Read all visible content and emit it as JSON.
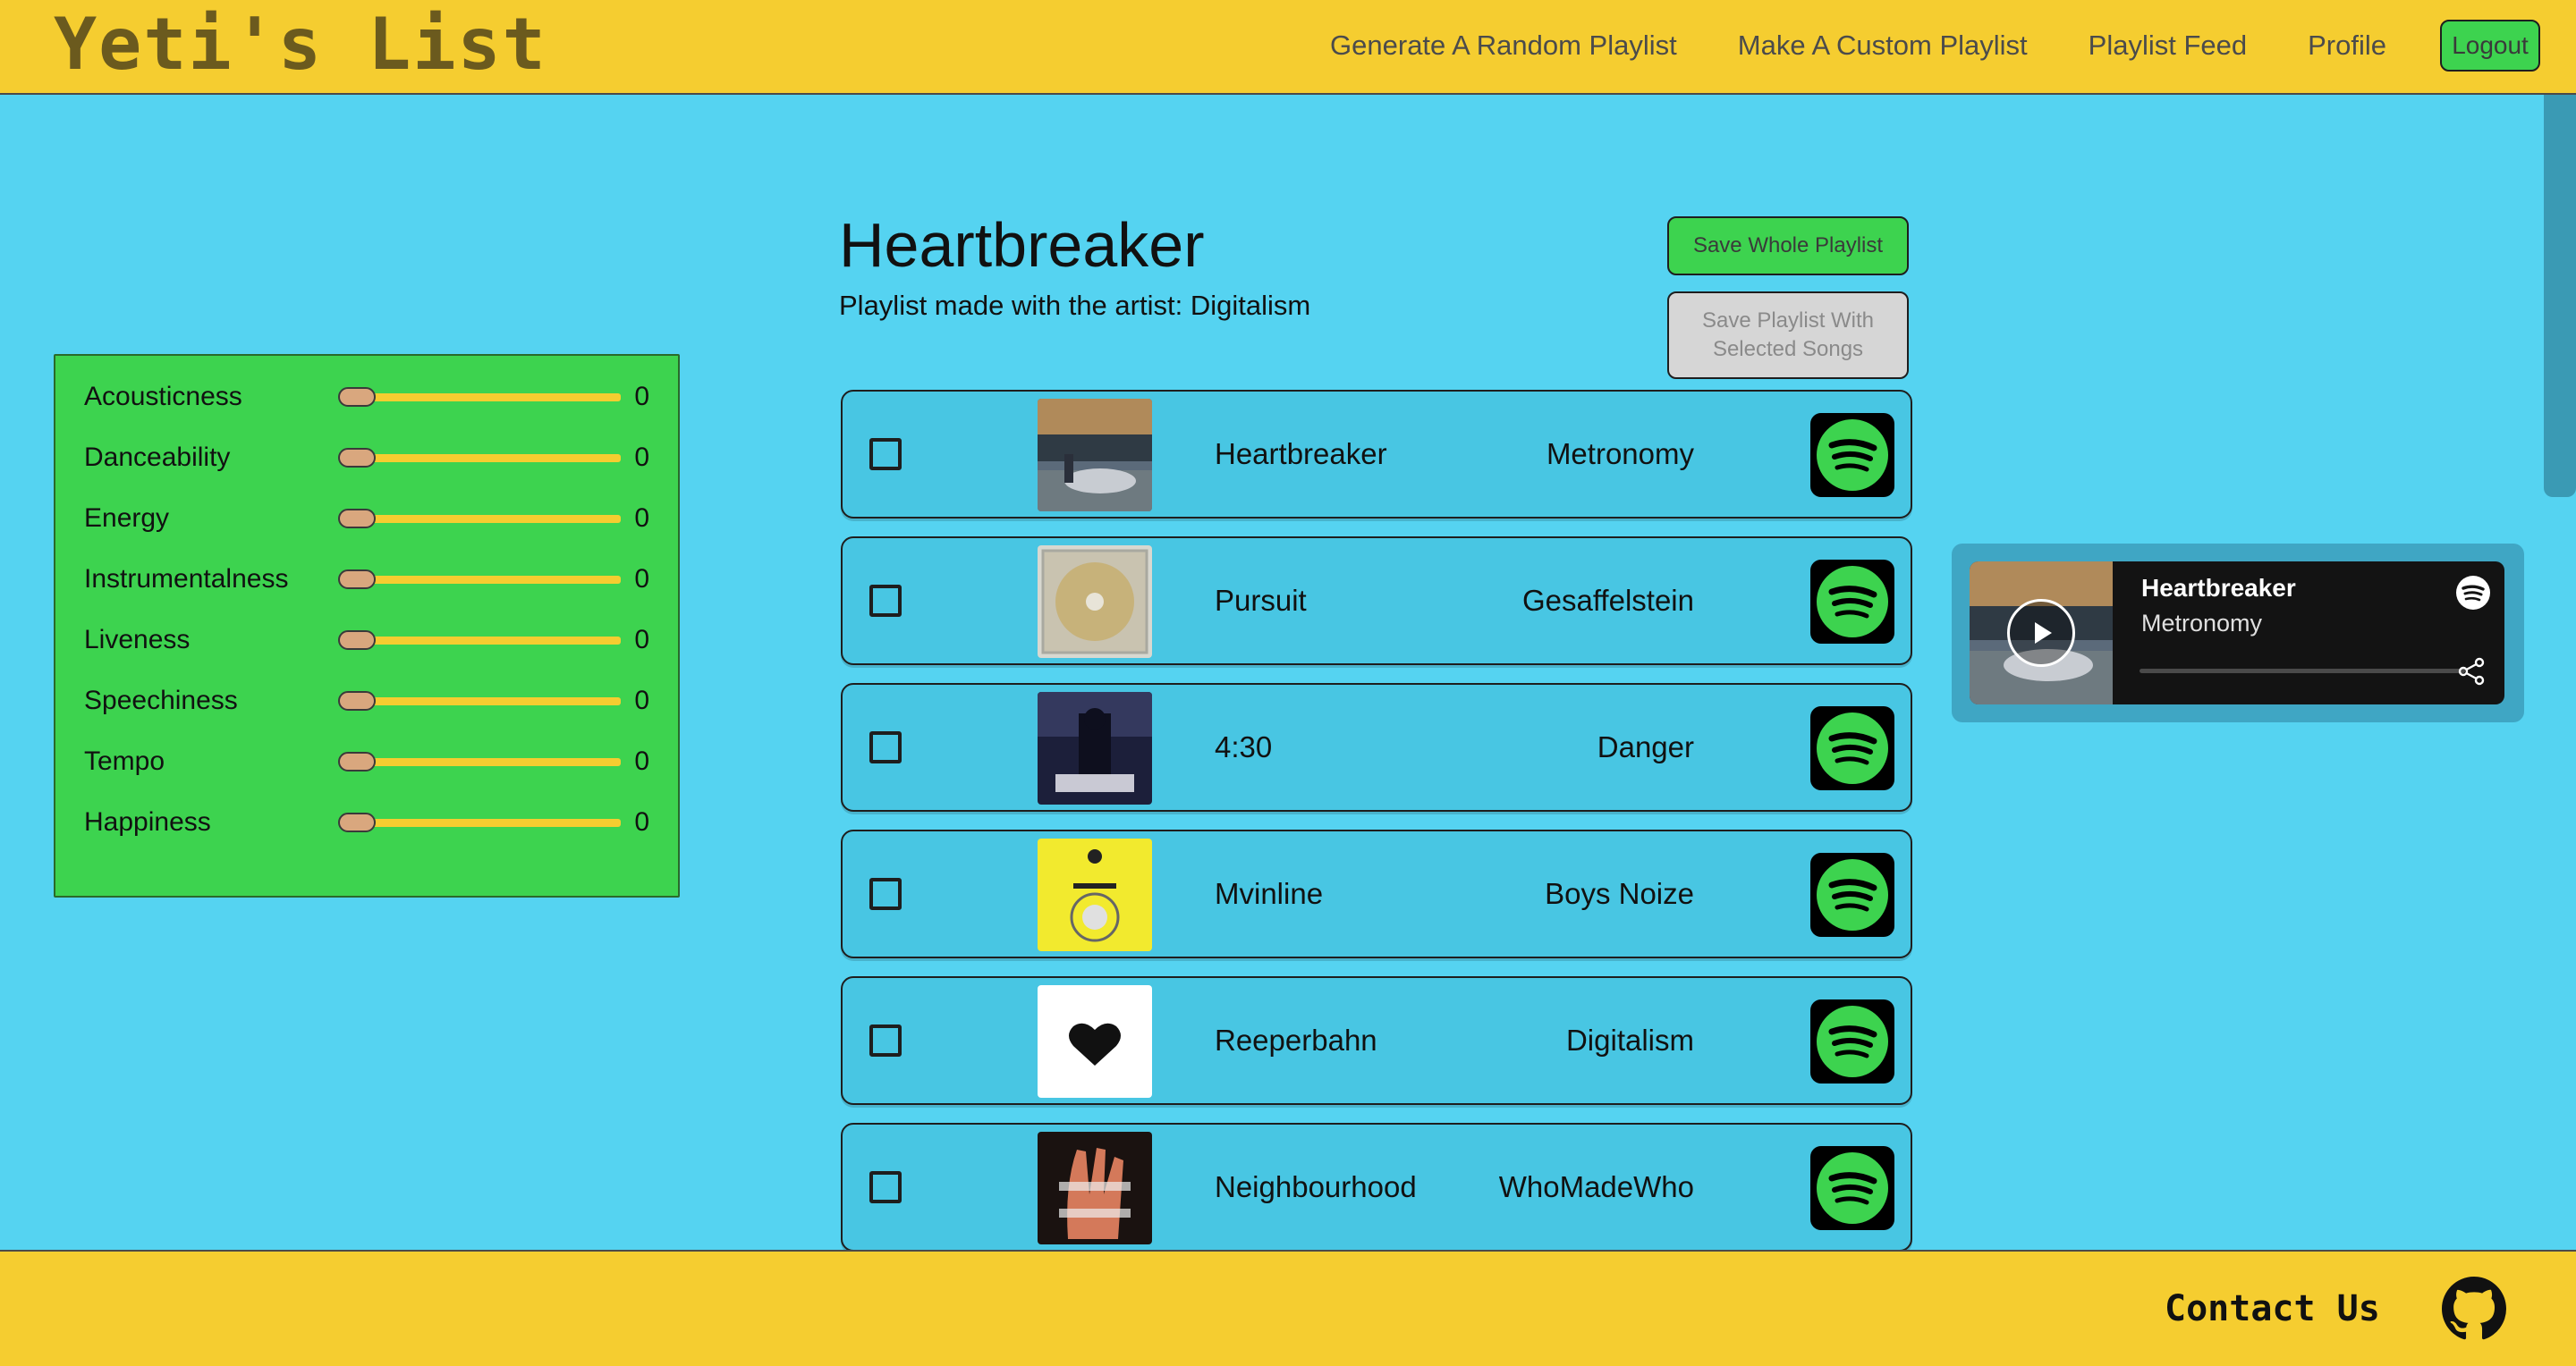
{
  "header": {
    "logo": "Yeti's List",
    "nav": [
      "Generate A Random Playlist",
      "Make A Custom Playlist",
      "Playlist Feed",
      "Profile"
    ],
    "logout_label": "Logout"
  },
  "features": [
    {
      "label": "Acousticness",
      "value": "0"
    },
    {
      "label": "Danceability",
      "value": "0"
    },
    {
      "label": "Energy",
      "value": "0"
    },
    {
      "label": "Instrumentalness",
      "value": "0"
    },
    {
      "label": "Liveness",
      "value": "0"
    },
    {
      "label": "Speechiness",
      "value": "0"
    },
    {
      "label": "Tempo",
      "value": "0"
    },
    {
      "label": "Happiness",
      "value": "0"
    }
  ],
  "playlist": {
    "title": "Heartbreaker",
    "subtitle": "Playlist made with the artist: Digitalism",
    "save_whole_label": "Save Whole Playlist",
    "save_selected_label": "Save Playlist With Selected Songs"
  },
  "songs": [
    {
      "name": "Heartbreaker",
      "artist": "Metronomy"
    },
    {
      "name": "Pursuit",
      "artist": "Gesaffelstein"
    },
    {
      "name": "4:30",
      "artist": "Danger"
    },
    {
      "name": "Mvinline",
      "artist": "Boys Noize"
    },
    {
      "name": "Reeperbahn",
      "artist": "Digitalism"
    },
    {
      "name": "Neighbourhood",
      "artist": "WhoMadeWho"
    }
  ],
  "player": {
    "song": "Heartbreaker",
    "artist": "Metronomy"
  },
  "footer": {
    "contact_label": "Contact Us"
  },
  "colors": {
    "background": "#55d3f1",
    "header_footer": "#f5cd30",
    "accent_green": "#3dd34f",
    "spotify_green": "#3dd34f"
  }
}
